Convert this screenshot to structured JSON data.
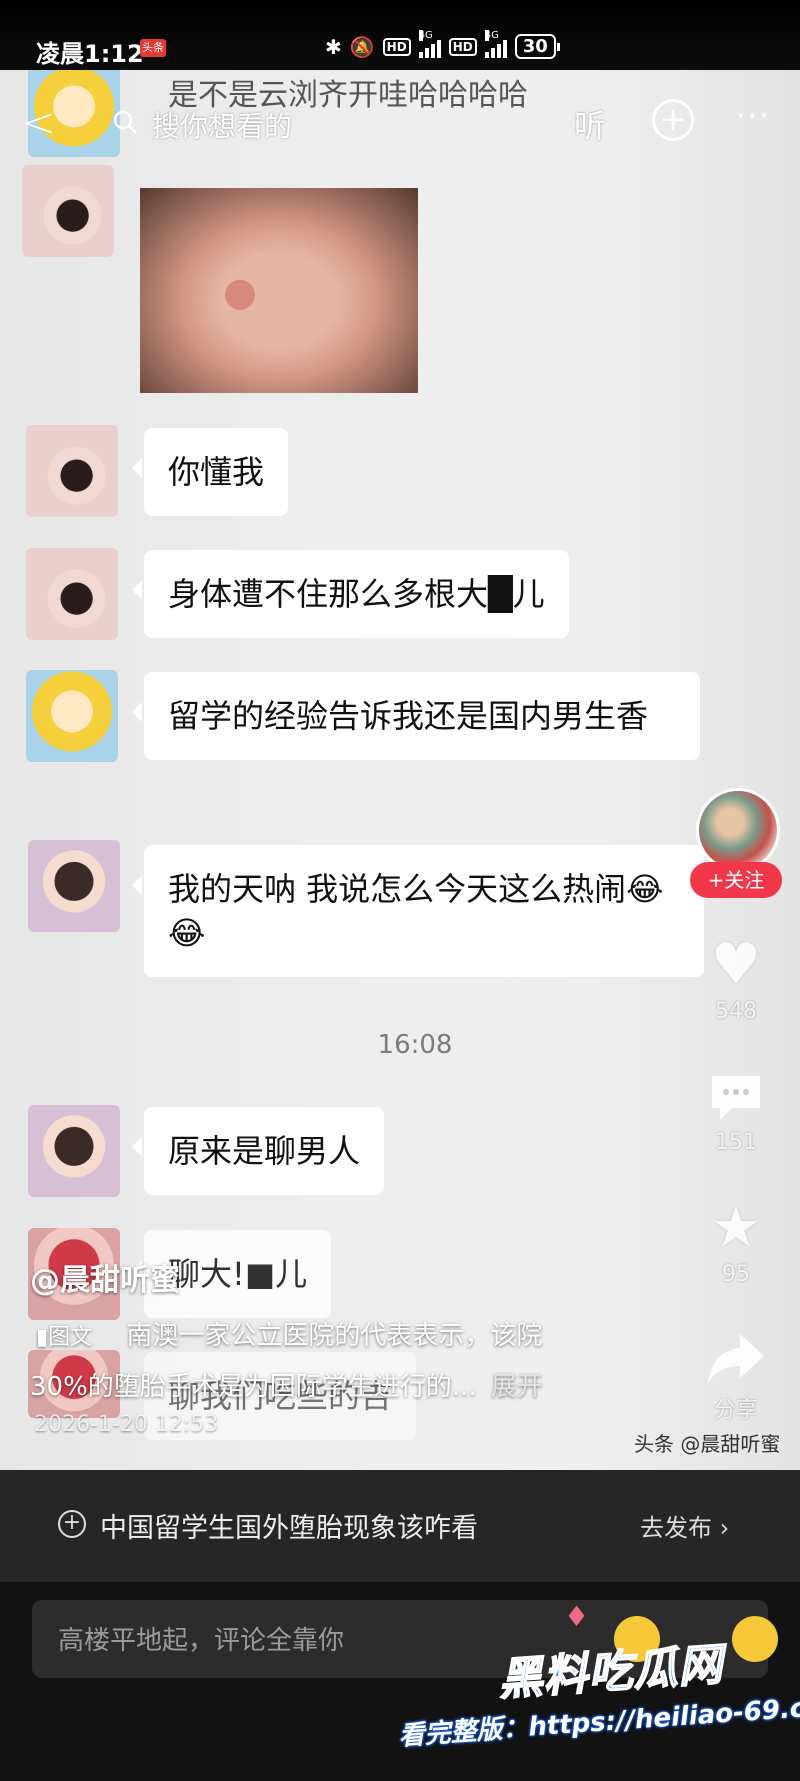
{
  "status_bar": {
    "time": "凌晨1:12",
    "app_badge": "头条",
    "net1": "4G",
    "net2": "4G",
    "hd": "HD",
    "battery": "30"
  },
  "top_bar": {
    "search_placeholder": "搜你想看的",
    "listen": "听"
  },
  "chat": {
    "partial_message": "是不是云浏齐开哇哈哈哈哈",
    "messages": [
      {
        "text": "你懂我"
      },
      {
        "text": "身体遭不住那么多根大█儿"
      },
      {
        "text": "留学的经验告诉我还是国内男生香"
      },
      {
        "text": "我的天呐 我说怎么今天这么热闹😂😂"
      },
      {
        "text": "原来是聊男人"
      },
      {
        "text": "聊大!■儿"
      },
      {
        "text": "聊我们吃些的吉"
      }
    ],
    "time_divider": "16:08"
  },
  "actions": {
    "follow": "+关注",
    "likes": "548",
    "comments": "151",
    "favorites": "95",
    "share": "分享"
  },
  "post": {
    "author": "@晨甜听蜜",
    "tag": "图文",
    "desc_line1": "南澳一家公立医院的代表表示，该院",
    "desc_line2": "30%的堕胎手术是为国际学生进行的...",
    "expand": "展开",
    "date": "2026-1-20 12:53",
    "source_watermark": "头条 @晨甜听蜜"
  },
  "topic": {
    "text": "中国留学生国外堕胎现象该咋看",
    "go": "去发布 ›"
  },
  "comment": {
    "placeholder": "高楼平地起，评论全靠你"
  },
  "site_watermark": {
    "logo": "黑料吃瓜网",
    "url": "看完整版：https://heiliao-69.com"
  }
}
